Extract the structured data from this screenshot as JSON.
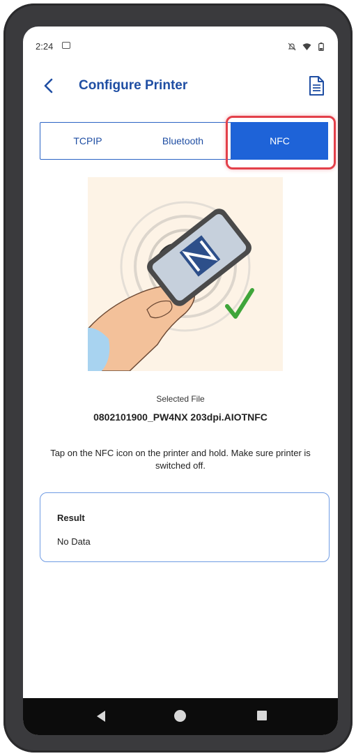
{
  "status_bar": {
    "time": "2:24",
    "icons": [
      "sim-card-icon",
      "mute-icon",
      "wifi-icon",
      "battery-icon"
    ]
  },
  "app_bar": {
    "title": "Configure Printer",
    "back_icon": "chevron-left-icon",
    "action_icon": "document-icon"
  },
  "tabs": [
    {
      "label": "TCPIP",
      "selected": false
    },
    {
      "label": "Bluetooth",
      "selected": false
    },
    {
      "label": "NFC",
      "selected": true
    }
  ],
  "selected_file": {
    "label": "Selected File",
    "name": "0802101900_PW4NX 203dpi.AIOTNFC"
  },
  "instruction": "Tap on the NFC icon on the printer and hold. Make sure printer is switched off.",
  "result": {
    "title": "Result",
    "value": "No Data"
  },
  "nav_bar": {
    "icons": [
      "back-triangle-icon",
      "home-circle-icon",
      "recents-square-icon"
    ]
  },
  "colors": {
    "accent": "#1e63d8",
    "title": "#1f4ea3",
    "highlight": "#e3404a"
  }
}
